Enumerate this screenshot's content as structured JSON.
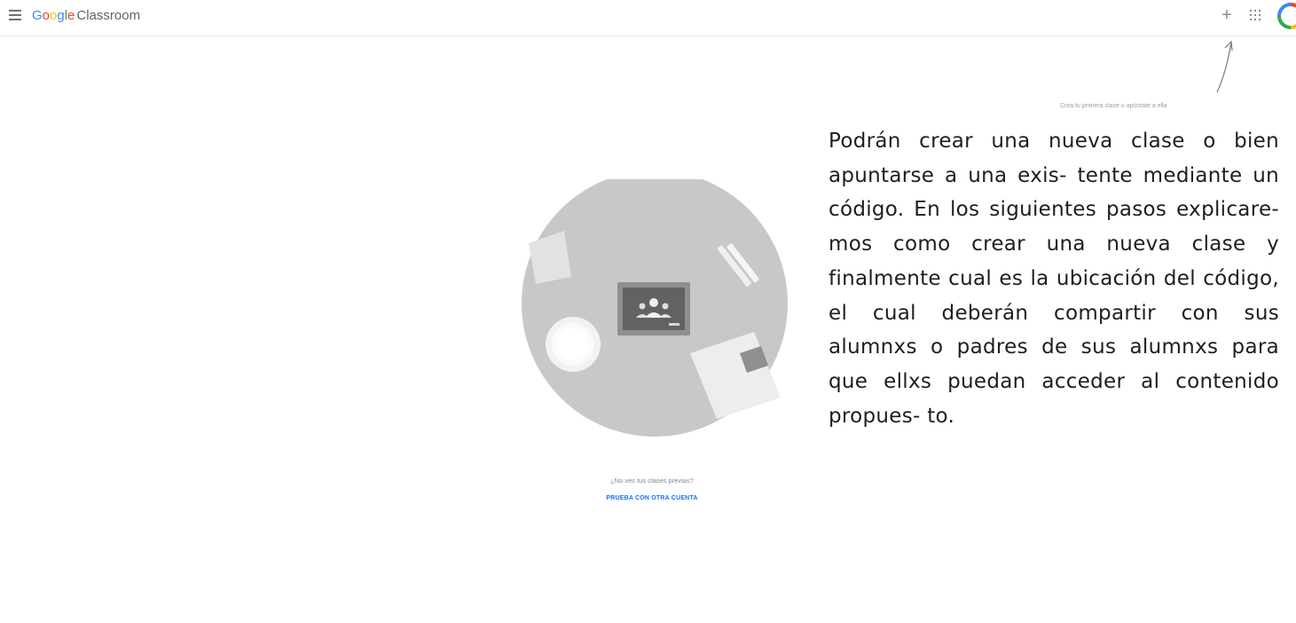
{
  "header": {
    "logo_letters": [
      {
        "char": "G",
        "color": "#4285f4"
      },
      {
        "char": "o",
        "color": "#ea4335"
      },
      {
        "char": "o",
        "color": "#fbbc05"
      },
      {
        "char": "g",
        "color": "#4285f4"
      },
      {
        "char": "l",
        "color": "#34a853"
      },
      {
        "char": "e",
        "color": "#ea4335"
      }
    ],
    "product": "Classroom",
    "menu_icon": "hamburger-menu-icon",
    "add_icon": "plus-icon",
    "add_symbol": "+",
    "apps_icon": "apps-grid-icon",
    "avatar_icon": "google-account-avatar"
  },
  "hint": {
    "text": "Crea tu primera clase o apúntate a ella"
  },
  "empty_state": {
    "prompt": "¿No ves tus clases previas?",
    "link": "PRUEBA CON OTRA CUENTA"
  },
  "note": {
    "text": "Podrán crear una nueva clase o bien apuntarse a una exis- tente mediante un código. En los siguientes pasos explicare- mos como crear una nueva clase y finalmente cual es la ubicación del código, el cual deberán compartir con sus alumnxs o padres de sus alumnxs para que ellxs puedan acceder al contenido propues- to."
  },
  "colors": {
    "link": "#1a73e8",
    "illustration_circle": "#c8c8c8"
  }
}
